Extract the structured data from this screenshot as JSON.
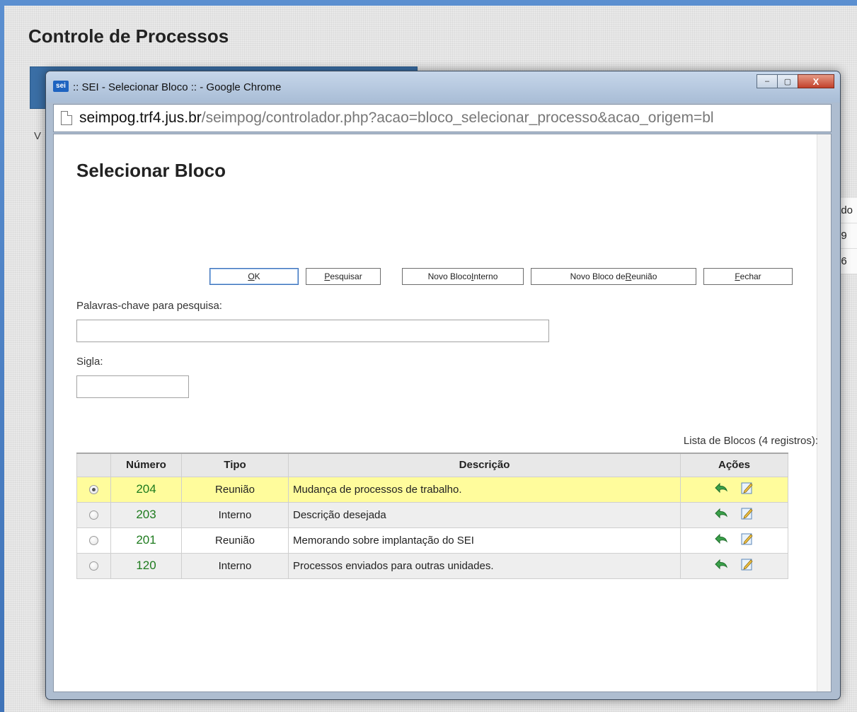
{
  "background_page": {
    "title": "Controle de Processos",
    "left_letter": "V",
    "right_fragments": [
      "ado",
      "79",
      "46"
    ]
  },
  "window": {
    "title": ":: SEI - Selecionar Bloco :: - Google Chrome",
    "logo_text": "sei",
    "controls": {
      "minimize": "–",
      "maximize": "▢",
      "close": "X"
    }
  },
  "addressbar": {
    "host": "seimpog.trf4.jus.br",
    "path": "/seimpog/controlador.php?acao=bloco_selecionar_processo&acao_origem=bl"
  },
  "page": {
    "title": "Selecionar Bloco",
    "buttons": {
      "ok": {
        "key": "O",
        "rest": "K"
      },
      "pesquisar": {
        "key": "P",
        "rest": "esquisar"
      },
      "novo_bloco_interno": {
        "pre": "Novo Bloco ",
        "key": "I",
        "rest": "nterno"
      },
      "novo_bloco_reuniao": {
        "pre": "Novo Bloco de ",
        "key": "R",
        "rest": "eunião"
      },
      "fechar": {
        "key": "F",
        "rest": "echar"
      }
    },
    "fields": {
      "keywords_label": "Palavras-chave para pesquisa:",
      "keywords_value": "",
      "sigla_label": "Sigla:",
      "sigla_value": ""
    },
    "list_caption": "Lista de Blocos (4 registros):",
    "table": {
      "headers": [
        "",
        "Número",
        "Tipo",
        "Descrição",
        "Ações"
      ],
      "rows": [
        {
          "numero": "204",
          "tipo": "Reunião",
          "descricao": "Mudança de processos de trabalho.",
          "selected": true
        },
        {
          "numero": "203",
          "tipo": "Interno",
          "descricao": "Descrição desejada",
          "selected": false
        },
        {
          "numero": "201",
          "tipo": "Reunião",
          "descricao": "Memorando sobre implantação do SEI",
          "selected": false
        },
        {
          "numero": "120",
          "tipo": "Interno",
          "descricao": "Processos enviados para outras unidades.",
          "selected": false
        }
      ]
    }
  },
  "colors": {
    "selected_row": "#fffc9c",
    "numero_text": "#1e7b1e",
    "window_close": "#c2412b",
    "action_arrow": "#3aa04a"
  },
  "icons": [
    "page-icon",
    "minimize-icon",
    "maximize-icon",
    "close-icon",
    "return-arrow-icon",
    "edit-icon"
  ]
}
